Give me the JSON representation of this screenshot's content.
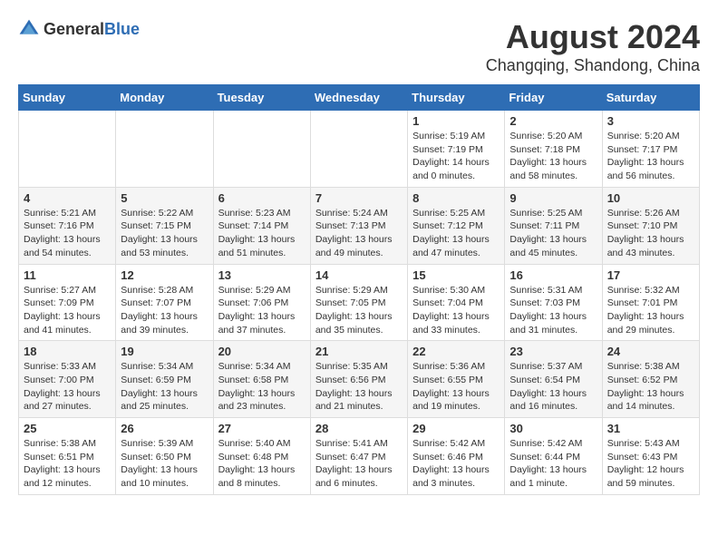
{
  "header": {
    "logo_general": "General",
    "logo_blue": "Blue",
    "title": "August 2024",
    "subtitle": "Changqing, Shandong, China"
  },
  "days_of_week": [
    "Sunday",
    "Monday",
    "Tuesday",
    "Wednesday",
    "Thursday",
    "Friday",
    "Saturday"
  ],
  "weeks": [
    [
      {
        "day": "",
        "content": ""
      },
      {
        "day": "",
        "content": ""
      },
      {
        "day": "",
        "content": ""
      },
      {
        "day": "",
        "content": ""
      },
      {
        "day": "1",
        "content": "Sunrise: 5:19 AM\nSunset: 7:19 PM\nDaylight: 14 hours\nand 0 minutes."
      },
      {
        "day": "2",
        "content": "Sunrise: 5:20 AM\nSunset: 7:18 PM\nDaylight: 13 hours\nand 58 minutes."
      },
      {
        "day": "3",
        "content": "Sunrise: 5:20 AM\nSunset: 7:17 PM\nDaylight: 13 hours\nand 56 minutes."
      }
    ],
    [
      {
        "day": "4",
        "content": "Sunrise: 5:21 AM\nSunset: 7:16 PM\nDaylight: 13 hours\nand 54 minutes."
      },
      {
        "day": "5",
        "content": "Sunrise: 5:22 AM\nSunset: 7:15 PM\nDaylight: 13 hours\nand 53 minutes."
      },
      {
        "day": "6",
        "content": "Sunrise: 5:23 AM\nSunset: 7:14 PM\nDaylight: 13 hours\nand 51 minutes."
      },
      {
        "day": "7",
        "content": "Sunrise: 5:24 AM\nSunset: 7:13 PM\nDaylight: 13 hours\nand 49 minutes."
      },
      {
        "day": "8",
        "content": "Sunrise: 5:25 AM\nSunset: 7:12 PM\nDaylight: 13 hours\nand 47 minutes."
      },
      {
        "day": "9",
        "content": "Sunrise: 5:25 AM\nSunset: 7:11 PM\nDaylight: 13 hours\nand 45 minutes."
      },
      {
        "day": "10",
        "content": "Sunrise: 5:26 AM\nSunset: 7:10 PM\nDaylight: 13 hours\nand 43 minutes."
      }
    ],
    [
      {
        "day": "11",
        "content": "Sunrise: 5:27 AM\nSunset: 7:09 PM\nDaylight: 13 hours\nand 41 minutes."
      },
      {
        "day": "12",
        "content": "Sunrise: 5:28 AM\nSunset: 7:07 PM\nDaylight: 13 hours\nand 39 minutes."
      },
      {
        "day": "13",
        "content": "Sunrise: 5:29 AM\nSunset: 7:06 PM\nDaylight: 13 hours\nand 37 minutes."
      },
      {
        "day": "14",
        "content": "Sunrise: 5:29 AM\nSunset: 7:05 PM\nDaylight: 13 hours\nand 35 minutes."
      },
      {
        "day": "15",
        "content": "Sunrise: 5:30 AM\nSunset: 7:04 PM\nDaylight: 13 hours\nand 33 minutes."
      },
      {
        "day": "16",
        "content": "Sunrise: 5:31 AM\nSunset: 7:03 PM\nDaylight: 13 hours\nand 31 minutes."
      },
      {
        "day": "17",
        "content": "Sunrise: 5:32 AM\nSunset: 7:01 PM\nDaylight: 13 hours\nand 29 minutes."
      }
    ],
    [
      {
        "day": "18",
        "content": "Sunrise: 5:33 AM\nSunset: 7:00 PM\nDaylight: 13 hours\nand 27 minutes."
      },
      {
        "day": "19",
        "content": "Sunrise: 5:34 AM\nSunset: 6:59 PM\nDaylight: 13 hours\nand 25 minutes."
      },
      {
        "day": "20",
        "content": "Sunrise: 5:34 AM\nSunset: 6:58 PM\nDaylight: 13 hours\nand 23 minutes."
      },
      {
        "day": "21",
        "content": "Sunrise: 5:35 AM\nSunset: 6:56 PM\nDaylight: 13 hours\nand 21 minutes."
      },
      {
        "day": "22",
        "content": "Sunrise: 5:36 AM\nSunset: 6:55 PM\nDaylight: 13 hours\nand 19 minutes."
      },
      {
        "day": "23",
        "content": "Sunrise: 5:37 AM\nSunset: 6:54 PM\nDaylight: 13 hours\nand 16 minutes."
      },
      {
        "day": "24",
        "content": "Sunrise: 5:38 AM\nSunset: 6:52 PM\nDaylight: 13 hours\nand 14 minutes."
      }
    ],
    [
      {
        "day": "25",
        "content": "Sunrise: 5:38 AM\nSunset: 6:51 PM\nDaylight: 13 hours\nand 12 minutes."
      },
      {
        "day": "26",
        "content": "Sunrise: 5:39 AM\nSunset: 6:50 PM\nDaylight: 13 hours\nand 10 minutes."
      },
      {
        "day": "27",
        "content": "Sunrise: 5:40 AM\nSunset: 6:48 PM\nDaylight: 13 hours\nand 8 minutes."
      },
      {
        "day": "28",
        "content": "Sunrise: 5:41 AM\nSunset: 6:47 PM\nDaylight: 13 hours\nand 6 minutes."
      },
      {
        "day": "29",
        "content": "Sunrise: 5:42 AM\nSunset: 6:46 PM\nDaylight: 13 hours\nand 3 minutes."
      },
      {
        "day": "30",
        "content": "Sunrise: 5:42 AM\nSunset: 6:44 PM\nDaylight: 13 hours\nand 1 minute."
      },
      {
        "day": "31",
        "content": "Sunrise: 5:43 AM\nSunset: 6:43 PM\nDaylight: 12 hours\nand 59 minutes."
      }
    ]
  ]
}
